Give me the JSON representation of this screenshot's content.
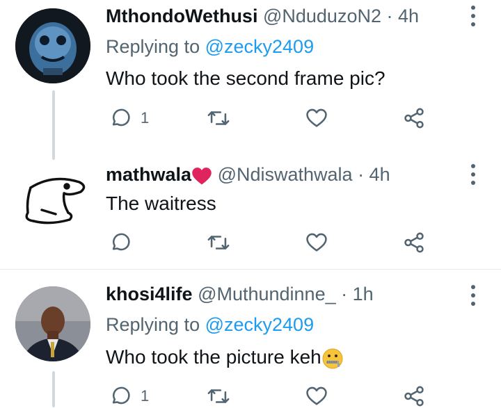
{
  "tweets": [
    {
      "name": "MthondoWethusi",
      "handle": "@NduduzoN2",
      "time": "· 4h",
      "replying_prefix": "Replying to ",
      "replying_to": "@zecky2409",
      "text": "Who took the second frame pic?",
      "reply_count": "1"
    },
    {
      "name": "mathwala",
      "handle": "@Ndiswathwala",
      "time": "· 4h",
      "text": "The waitress"
    },
    {
      "name": "khosi4life",
      "handle": "@Muthundinne_",
      "time": "· 1h",
      "replying_prefix": "Replying to ",
      "replying_to": "@zecky2409",
      "text": "Who took the picture keh",
      "reply_count": "1"
    }
  ],
  "icons": {
    "reply": "speech-bubble-icon",
    "retweet": "retweet-icon",
    "like": "heart-icon",
    "share": "share-icon",
    "more": "vertical-dots-icon"
  },
  "colors": {
    "accent": "#1d9bf0",
    "muted": "#536471",
    "heart_emoji": "#e0245e"
  }
}
